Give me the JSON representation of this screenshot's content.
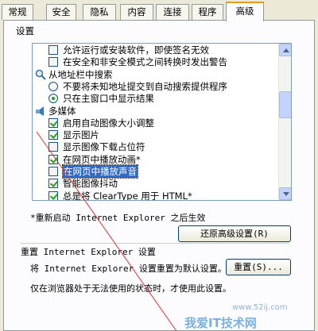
{
  "tabs": [
    "常规",
    "安全",
    "隐私",
    "内容",
    "连接",
    "程序",
    "高级"
  ],
  "active_tab": "高级",
  "settings_label": "设置",
  "list_items": [
    {
      "type": "checkbox",
      "checked": false,
      "label": "允许运行或安装软件，即使签名无效"
    },
    {
      "type": "checkbox",
      "checked": false,
      "label": "在安全和非安全模式之间转换时发出警告"
    },
    {
      "type": "group",
      "icon": "search-icon",
      "label": "从地址栏中搜索"
    },
    {
      "type": "radio",
      "checked": false,
      "label": "不要将未知地址提交到自动搜索提供程序"
    },
    {
      "type": "radio",
      "checked": true,
      "label": "只在主窗口中显示结果"
    },
    {
      "type": "group",
      "icon": "multimedia-icon",
      "label": "多媒体"
    },
    {
      "type": "checkbox",
      "checked": true,
      "label": "启用自动图像大小调整"
    },
    {
      "type": "checkbox",
      "checked": true,
      "label": "显示图片"
    },
    {
      "type": "checkbox",
      "checked": false,
      "label": "显示图像下载占位符"
    },
    {
      "type": "checkbox",
      "checked": true,
      "label": "在网页中播放动画*"
    },
    {
      "type": "checkbox",
      "checked": false,
      "label": "在网页中播放声音",
      "selected": true
    },
    {
      "type": "checkbox",
      "checked": true,
      "label": "智能图像抖动"
    },
    {
      "type": "checkbox",
      "checked": true,
      "label": "总是将 ClearType 用于 HTML*"
    }
  ],
  "restart_note": "*重新启动 Internet Explorer 之后生效",
  "restore_button": "还原高级设置(R)",
  "reset_section_title": "重置 Internet Explorer 设置",
  "reset_description": "将 Internet Explorer 设置重置为默认设置。",
  "reset_button": "重置(S)...",
  "reset_hint": "仅在浏览器处于无法使用的状态时，才使用此设置。",
  "watermark": "我爱IT技术网",
  "watermark_url": "www.52ij.com"
}
